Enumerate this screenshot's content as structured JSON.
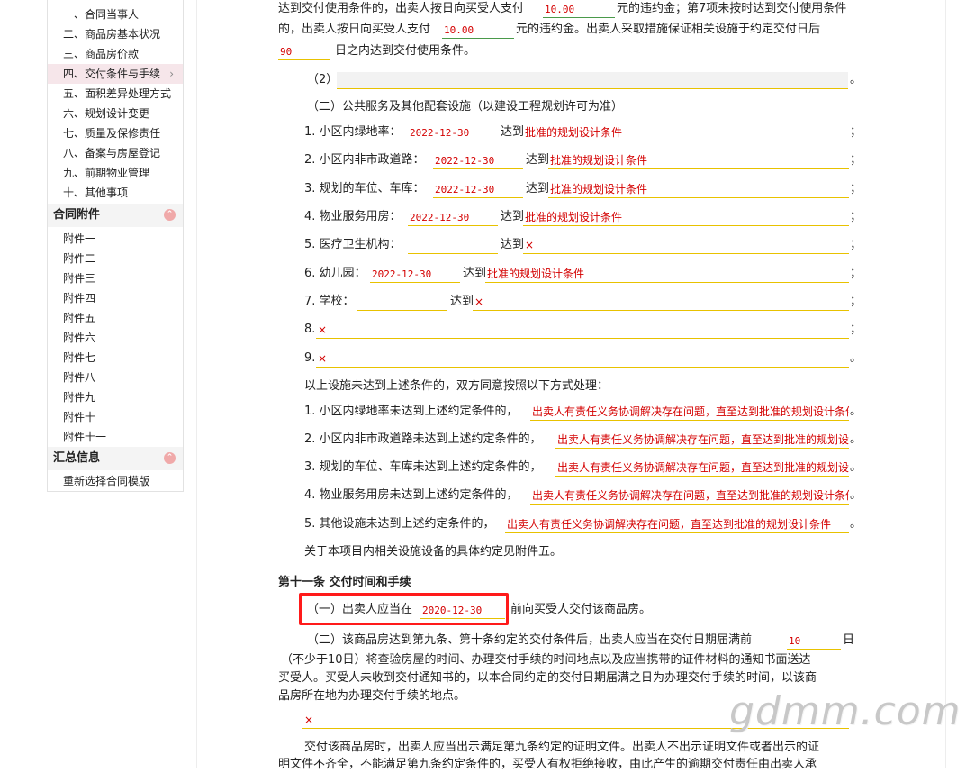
{
  "sidebar": {
    "contract_items": [
      "一、合同当事人",
      "二、商品房基本状况",
      "三、商品房价款",
      "四、交付条件与手续",
      "五、面积差异处理方式",
      "六、规划设计变更",
      "七、质量及保修责任",
      "八、备案与房屋登记",
      "九、前期物业管理",
      "十、其他事项"
    ],
    "active_chevron": "›",
    "attachments_title": "合同附件",
    "attachments": [
      "附件一",
      "附件二",
      "附件三",
      "附件四",
      "附件五",
      "附件六",
      "附件七",
      "附件八",
      "附件九",
      "附件十",
      "附件十一"
    ],
    "summary_title": "汇总信息",
    "summary_items": [
      "重新选择合同模版"
    ],
    "collapse_glyph": "⌃"
  },
  "doc": {
    "p1_a": "达到交付使用条件的，出卖人按日向买受人支付",
    "p1_v1": "10.00",
    "p1_b": "元的违约金；第7项未按时达到交付使用条件",
    "p1_c": "的，出卖人按日向买受人支付",
    "p1_v2": "10.00",
    "p1_d": "元的违约金。出卖人采取措施保证相关设施于约定交付日后",
    "p1_v3": "90",
    "p1_e": "日之内达到交付使用条件。",
    "item2_label": "（2）",
    "end_period": "。",
    "section2_title": "（二）公共服务及其他配套设施（以建设工程规划许可为准）",
    "reach": "达到",
    "semicolon": "；",
    "facilities": [
      {
        "label": "1. 小区内绿地率：",
        "date": "2022-12-30",
        "cond": "批准的规划设计条件"
      },
      {
        "label": "2. 小区内非市政道路：",
        "date": "2022-12-30",
        "cond": "批准的规划设计条件"
      },
      {
        "label": "3. 规划的车位、车库：",
        "date": "2022-12-30",
        "cond": "批准的规划设计条件"
      },
      {
        "label": "4. 物业服务用房：",
        "date": "2022-12-30",
        "cond": "批准的规划设计条件"
      },
      {
        "label": "5. 医疗卫生机构：",
        "date": "",
        "cond": "×"
      },
      {
        "label": "6. 幼儿园：",
        "date": "2022-12-30",
        "cond": "批准的规划设计条件"
      },
      {
        "label": "7. 学校：",
        "date": "",
        "cond": "×"
      }
    ],
    "item8_label": "8.",
    "item8_value": "×",
    "item9_label": "9.",
    "item9_value": "×",
    "handling_intro": "以上设施未达到上述条件的，双方同意按照以下方式处理：",
    "remedies": [
      {
        "label": "1. 小区内绿地率未达到上述约定条件的，",
        "value": "出卖人有责任义务协调解决存在问题，直至达到批准的规划设计条件"
      },
      {
        "label": "2. 小区内非市政道路未达到上述约定条件的，",
        "value": "出卖人有责任义务协调解决存在问题，直至达到批准的规划设计条件"
      },
      {
        "label": "3. 规划的车位、车库未达到上述约定条件的，",
        "value": "出卖人有责任义务协调解决存在问题，直至达到批准的规划设计条件"
      },
      {
        "label": "4. 物业服务用房未达到上述约定条件的，",
        "value": "出卖人有责任义务协调解决存在问题，直至达到批准的规划设计条件"
      },
      {
        "label": "5. 其他设施未达到上述约定条件的，",
        "value": "出卖人有责任义务协调解决存在问题，直至达到批准的规划设计条件"
      }
    ],
    "attachment_note": "关于本项目内相关设施设备的具体约定见附件五。",
    "article11_title": "第十一条  交付时间和手续",
    "a11_p1_a": "（一）出卖人应当在",
    "a11_p1_date": "2020-12-30",
    "a11_p1_b": "前向买受人交付该商品房。",
    "a11_p2_a": "（二）该商品房达到第九条、第十条约定的交付条件后，出卖人应当在交付日期届满前",
    "a11_p2_days": "10",
    "a11_p2_b": "日",
    "a11_p2_line2": "（不少于10日）将查验房屋的时间、办理交付手续的时间地点以及应当携带的证件材料的通知书面送达",
    "a11_p2_line3": "买受人。买受人未收到交付通知书的，以本合同约定的交付日期届满之日为办理交付手续的时间，以该商",
    "a11_p2_line4": "品房所在地为办理交付手续的地点。",
    "a11_extra_value": "×",
    "a11_p3_line1": "交付该商品房时，出卖人应当出示满足第九条约定的证明文件。出卖人不出示证明文件或者出示的证",
    "a11_p3_line2": "明文件不齐全，不能满足第九条约定条件的，买受人有权拒绝接收，由此产生的逾期交付责任由出卖人承"
  },
  "watermark": "gdmm.com",
  "colors": {
    "accent_red": "#d40000",
    "underline_yellow": "#e8c200",
    "highlight_red": "#ff1a1a",
    "active_bg": "#f6e6ea"
  }
}
